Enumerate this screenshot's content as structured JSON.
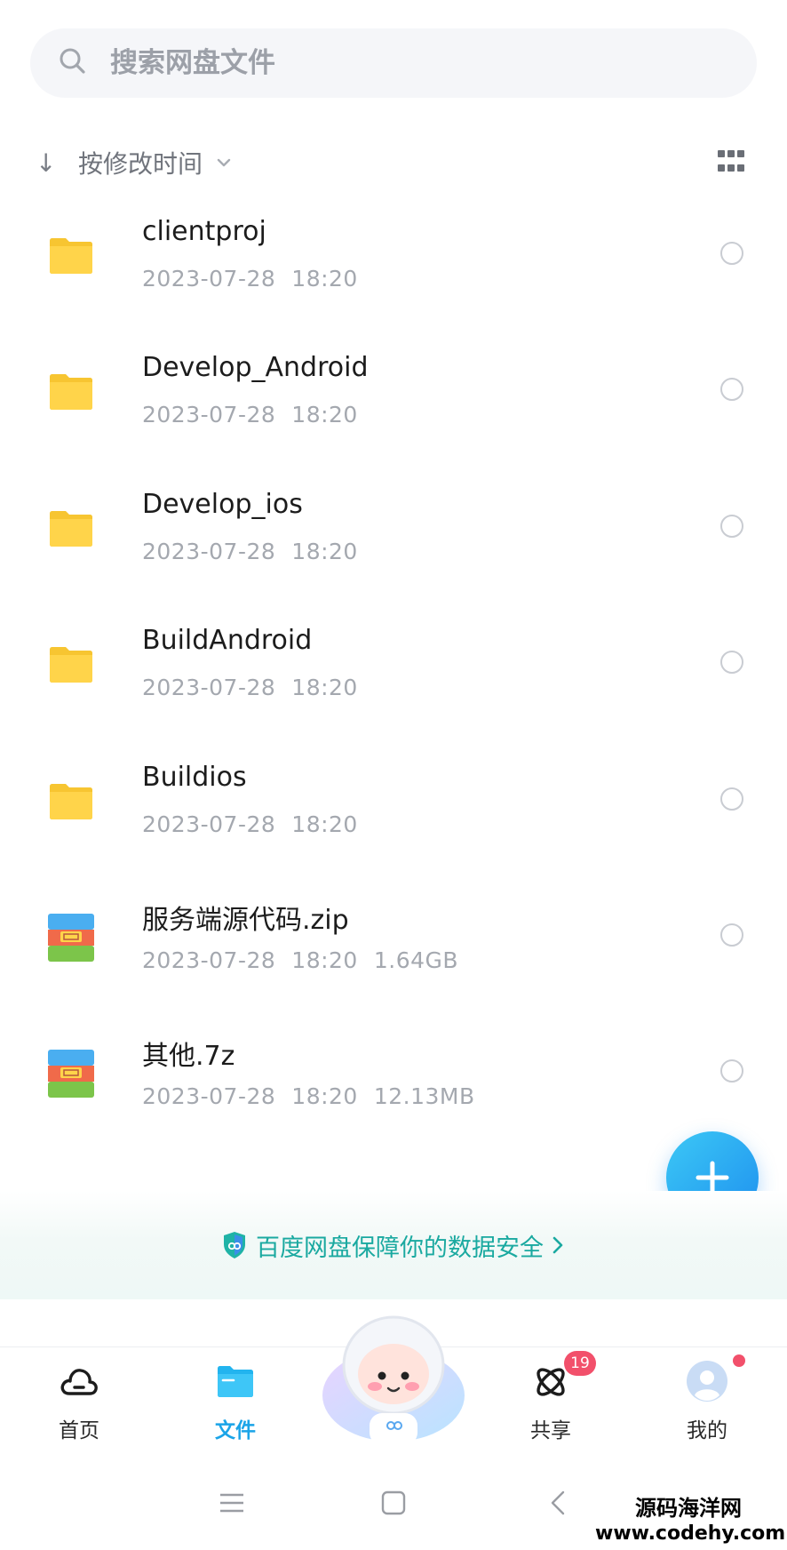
{
  "search": {
    "placeholder": "搜索网盘文件"
  },
  "sort": {
    "label": "按修改时间"
  },
  "files": [
    {
      "name": "clientproj",
      "date": "2023-07-28",
      "time": "18:20",
      "size": "",
      "type": "folder"
    },
    {
      "name": "Develop_Android",
      "date": "2023-07-28",
      "time": "18:20",
      "size": "",
      "type": "folder"
    },
    {
      "name": "Develop_ios",
      "date": "2023-07-28",
      "time": "18:20",
      "size": "",
      "type": "folder"
    },
    {
      "name": "BuildAndroid",
      "date": "2023-07-28",
      "time": "18:20",
      "size": "",
      "type": "folder"
    },
    {
      "name": "Buildios",
      "date": "2023-07-28",
      "time": "18:20",
      "size": "",
      "type": "folder"
    },
    {
      "name": "服务端源代码.zip",
      "date": "2023-07-28",
      "time": "18:20",
      "size": "1.64GB",
      "type": "archive"
    },
    {
      "name": "其他.7z",
      "date": "2023-07-28",
      "time": "18:20",
      "size": "12.13MB",
      "type": "archive"
    }
  ],
  "security_banner": {
    "text": "百度网盘保障你的数据安全"
  },
  "nav": {
    "home": {
      "label": "首页",
      "icon": "cloud-icon"
    },
    "files": {
      "label": "文件",
      "icon": "folder-icon"
    },
    "share": {
      "label": "共享",
      "icon": "atom-icon",
      "badge": "19"
    },
    "me": {
      "label": "我的",
      "icon": "avatar-icon"
    }
  },
  "watermark": {
    "line1": "源码海洋网",
    "line2": "www.codehy.com"
  },
  "colors": {
    "accent": "#1aa4e8",
    "folder": "#ffd44a",
    "security": "#1aa9a0",
    "badge": "#f2506b"
  }
}
